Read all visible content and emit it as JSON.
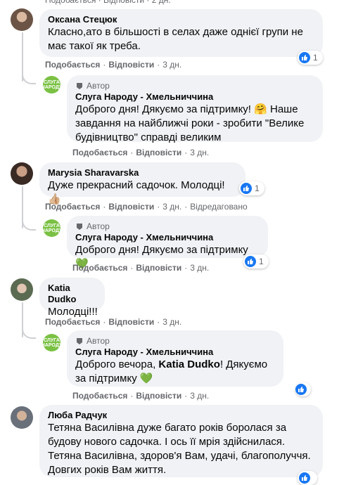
{
  "top_partial": {
    "actions": "Подобається · Відповісти · 2 дн."
  },
  "comments": [
    {
      "author": "Оксана Стецюк",
      "text": "Класно,ато в більшості в селах даже однієї групи не має такої як треба.",
      "reactions": "1",
      "like": "Подобається",
      "reply": "Відповісти",
      "time": "3 дн."
    },
    {
      "badge": "Автор",
      "author": "Слуга Народу - Хмельниччина",
      "text": "Доброго дня! Дякуємо за підтримку! 🤗 Наше завдання на найближчі роки - зробити \"Велике будівництво\" справді великим",
      "like": "Подобається",
      "reply": "Відповісти",
      "time": "3 дн."
    },
    {
      "author": "Marysia Sharavarska",
      "text": "Дуже прекрасний садочок. Молодці!👍🏼",
      "reactions": "1",
      "like": "Подобається",
      "reply": "Відповісти",
      "time": "3 дн.",
      "edited": "Відредаговано"
    },
    {
      "badge": "Автор",
      "author": "Слуга Народу - Хмельниччина",
      "text": "Доброго дня! Дякуємо за підтримку💚",
      "reactions": "1",
      "like": "Подобається",
      "reply": "Відповісти",
      "time": "3 дн."
    },
    {
      "author": "Katia Dudko",
      "text": "Молодці!!!",
      "like": "Подобається",
      "reply": "Відповісти",
      "time": "3 дн."
    },
    {
      "badge": "Автор",
      "author": "Слуга Народу - Хмельниччина",
      "text_prefix": "Доброго вечора, ",
      "mention": "Katia Dudko",
      "text_suffix": "! Дякуємо за підтримку 💚",
      "like": "Подобається",
      "reply": "Відповісти",
      "time": "3 дн."
    },
    {
      "author": "Люба Радчук",
      "text": "Тетяна Василівна дуже багато років боролася за будову нового садочка. І ось її мрія здійснилася. Тетяна Василівна, здоров'я Вам, удачі, благополуччя. Довгих років Вам життя."
    }
  ],
  "brand_avatar_text": "СЛУГА НАРОДУ",
  "colors": {
    "brand_green": "#7ac143",
    "like_blue": "#1877f2",
    "bubble_gray": "#f0f2f5",
    "meta_gray": "#65676b"
  }
}
